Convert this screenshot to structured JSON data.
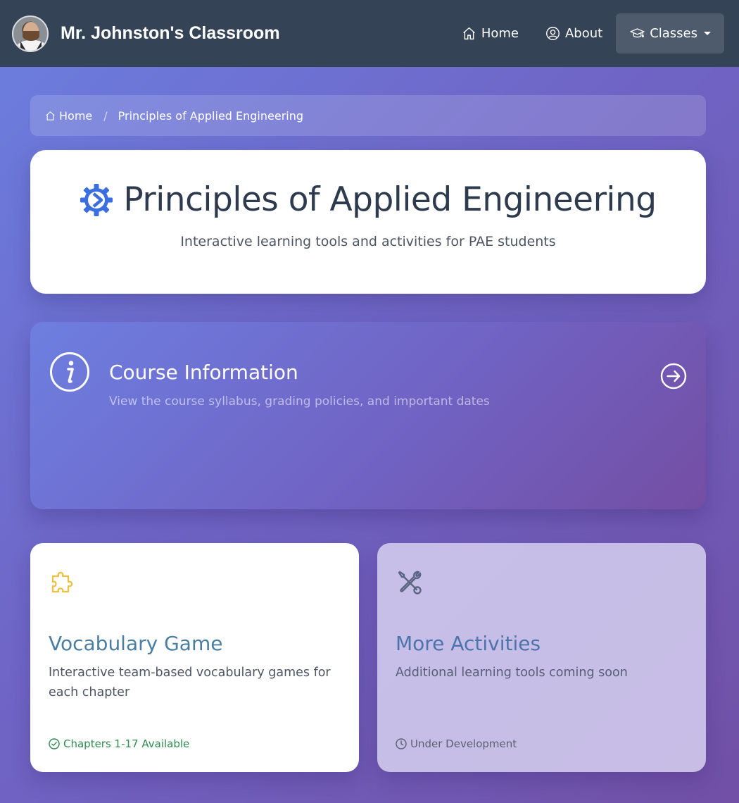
{
  "nav": {
    "brand": "Mr. Johnston's Classroom",
    "links": [
      {
        "label": "Home",
        "icon": "home-icon"
      },
      {
        "label": "About",
        "icon": "user-circle-icon"
      },
      {
        "label": "Classes",
        "icon": "mortarboard-icon",
        "active": true,
        "dropdown": true
      }
    ]
  },
  "breadcrumb": {
    "home": "Home",
    "separator": "/",
    "current": "Principles of Applied Engineering"
  },
  "hero": {
    "title": "Principles of Applied Engineering",
    "subtitle": "Interactive learning tools and activities for PAE students",
    "icon": "gear-icon",
    "icon_color": "#3b6fe0"
  },
  "course_info": {
    "title": "Course Information",
    "description": "View the course syllabus, grading policies, and important dates",
    "icon": "info-icon",
    "action_icon": "arrow-right-circle-icon"
  },
  "cards": [
    {
      "title": "Vocabulary Game",
      "description": "Interactive team-based vocabulary games for each chapter",
      "status": "Chapters 1-17 Available",
      "icon": "puzzle-icon",
      "status_icon": "check-circle-icon",
      "icon_color": "#f0c040",
      "status_color": "#2f8a4e"
    },
    {
      "title": "More Activities",
      "description": "Additional learning tools coming soon",
      "status": "Under Development",
      "icon": "tools-icon",
      "status_icon": "clock-icon",
      "icon_color": "#5a6480",
      "status_color": "#5a6070"
    }
  ],
  "colors": {
    "navbar": "#344356",
    "accent_blue": "#3b6fe0",
    "gradient_start": "#6b7fe0",
    "gradient_end": "#7150a6"
  }
}
